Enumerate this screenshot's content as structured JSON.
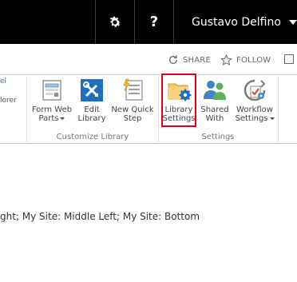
{
  "suite_bar": {
    "settings_icon": "gear-icon",
    "help_label": "?",
    "user_name": "Gustavo Delfino"
  },
  "actions": {
    "share_label": "SHARE",
    "follow_label": "FOLLOW"
  },
  "ribbon": {
    "left_fragments": [
      "el",
      "lorer"
    ],
    "groups": [
      {
        "label": "Customize Library",
        "buttons": [
          {
            "label_line1": "Form Web",
            "label_line2": "Parts",
            "has_dropdown": true,
            "icon": "form-web-parts-icon"
          },
          {
            "label_line1": "Edit",
            "label_line2": "Library",
            "has_dropdown": false,
            "icon": "edit-library-icon"
          },
          {
            "label_line1": "New Quick",
            "label_line2": "Step",
            "has_dropdown": false,
            "icon": "new-quick-step-icon"
          }
        ]
      },
      {
        "label": "Settings",
        "buttons": [
          {
            "label_line1": "Library",
            "label_line2": "Settings",
            "has_dropdown": false,
            "icon": "library-settings-icon",
            "highlighted": true
          },
          {
            "label_line1": "Shared",
            "label_line2": "With",
            "has_dropdown": false,
            "icon": "shared-with-icon"
          },
          {
            "label_line1": "Workflow",
            "label_line2": "Settings",
            "has_dropdown": true,
            "icon": "workflow-settings-icon"
          }
        ]
      }
    ]
  },
  "content": {
    "zone_text": "ght; My Site: Middle Left; My Site: Bottom"
  },
  "colors": {
    "suite_bar_bg": "#000000",
    "highlight_border": "#e0001b",
    "accent_blue": "#0072c6"
  }
}
